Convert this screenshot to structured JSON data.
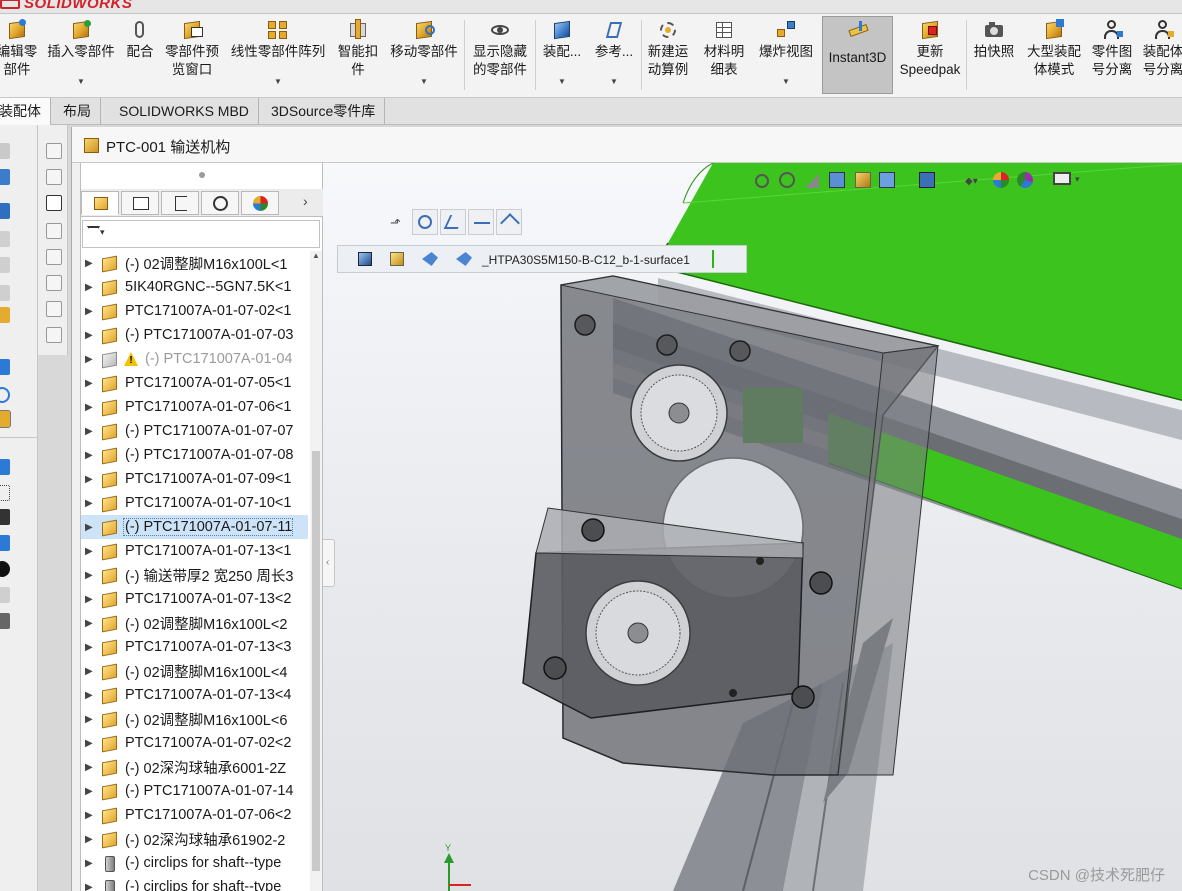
{
  "app": {
    "logo": "SOLIDWORKS"
  },
  "ribbon": {
    "buttons": [
      {
        "id": "edit-part",
        "label": "编辑零\n部件"
      },
      {
        "id": "insert-part",
        "label": "插入零部件"
      },
      {
        "id": "mate",
        "label": "配合"
      },
      {
        "id": "preview",
        "label": "零部件预\n览窗口"
      },
      {
        "id": "linear-pattern",
        "label": "线性零部件阵列"
      },
      {
        "id": "smart-fastener",
        "label": "智能扣\n件"
      },
      {
        "id": "move-part",
        "label": "移动零部件"
      },
      {
        "id": "show-hidden",
        "label": "显示隐藏\n的零部件"
      },
      {
        "id": "assembly-feature",
        "label": "装配..."
      },
      {
        "id": "reference",
        "label": "参考..."
      },
      {
        "id": "new-motion",
        "label": "新建运\n动算例"
      },
      {
        "id": "bom",
        "label": "材料明\n细表"
      },
      {
        "id": "exploded-view",
        "label": "爆炸视图"
      },
      {
        "id": "instant3d",
        "label": "Instant3D"
      },
      {
        "id": "speedpak",
        "label": "更新\nSpeedpak"
      },
      {
        "id": "snapshot",
        "label": "拍快照"
      },
      {
        "id": "large-assembly",
        "label": "大型装配\n体模式"
      },
      {
        "id": "part-drawing",
        "label": "零件图\n号分离"
      },
      {
        "id": "assembly-drawing",
        "label": "装配体\n号分离"
      }
    ]
  },
  "tabs": [
    {
      "label": "装配体"
    },
    {
      "label": "布局"
    },
    {
      "label": "SOLIDWORKS MBD"
    },
    {
      "label": "3DSource零件库"
    }
  ],
  "document": {
    "title": "PTC-001 输送机构"
  },
  "tree": {
    "nodes": [
      {
        "text": "(-) 02调整脚M16x100L<1",
        "icon": "part",
        "state": "normal"
      },
      {
        "text": "5IK40RGNC--5GN7.5K<1",
        "icon": "part",
        "state": "normal"
      },
      {
        "text": "PTC171007A-01-07-02<1",
        "icon": "part",
        "state": "normal"
      },
      {
        "text": "(-) PTC171007A-01-07-03",
        "icon": "part",
        "state": "normal"
      },
      {
        "text": "(-) PTC171007A-01-04",
        "icon": "gray",
        "state": "disabled"
      },
      {
        "text": "PTC171007A-01-07-05<1",
        "icon": "part",
        "state": "normal"
      },
      {
        "text": "PTC171007A-01-07-06<1",
        "icon": "part",
        "state": "normal"
      },
      {
        "text": "(-) PTC171007A-01-07-07",
        "icon": "part",
        "state": "normal"
      },
      {
        "text": "(-) PTC171007A-01-07-08",
        "icon": "part",
        "state": "normal"
      },
      {
        "text": "PTC171007A-01-07-09<1",
        "icon": "part",
        "state": "normal"
      },
      {
        "text": "PTC171007A-01-07-10<1",
        "icon": "part",
        "state": "normal"
      },
      {
        "text": "(-) PTC171007A-01-07-11",
        "icon": "part",
        "state": "selected"
      },
      {
        "text": "PTC171007A-01-07-13<1",
        "icon": "part",
        "state": "normal"
      },
      {
        "text": "(-) 输送带厚2 宽250 周长3",
        "icon": "part",
        "state": "normal"
      },
      {
        "text": "PTC171007A-01-07-13<2",
        "icon": "part",
        "state": "normal"
      },
      {
        "text": "(-) 02调整脚M16x100L<2",
        "icon": "part",
        "state": "normal"
      },
      {
        "text": "PTC171007A-01-07-13<3",
        "icon": "part",
        "state": "normal"
      },
      {
        "text": "(-) 02调整脚M16x100L<4",
        "icon": "part",
        "state": "normal"
      },
      {
        "text": "PTC171007A-01-07-13<4",
        "icon": "part",
        "state": "normal"
      },
      {
        "text": "(-) 02调整脚M16x100L<6",
        "icon": "part",
        "state": "normal"
      },
      {
        "text": "PTC171007A-01-07-02<2",
        "icon": "part",
        "state": "normal"
      },
      {
        "text": "(-) 02深沟球轴承6001-2Z",
        "icon": "part",
        "state": "normal"
      },
      {
        "text": "(-) PTC171007A-01-07-14",
        "icon": "part",
        "state": "normal"
      },
      {
        "text": "PTC171007A-01-07-06<2",
        "icon": "part",
        "state": "normal"
      },
      {
        "text": "(-) 02深沟球轴承61902-2",
        "icon": "part",
        "state": "normal"
      },
      {
        "text": "(-) circlips for shaft--type",
        "icon": "bolt",
        "state": "normal"
      },
      {
        "text": "(-) circlips for shaft--type",
        "icon": "bolt",
        "state": "normal"
      }
    ]
  },
  "viewport": {
    "breadcrumb_text": "_HTPA30S5M150-B-C12_b-1-surface1",
    "watermark": "CSDN @技术死肥仔",
    "colors": {
      "belt": "#3cc31e",
      "frame": "#9da1a6",
      "housing": "#5f6166",
      "bg_top": "#f7f8fb"
    }
  }
}
